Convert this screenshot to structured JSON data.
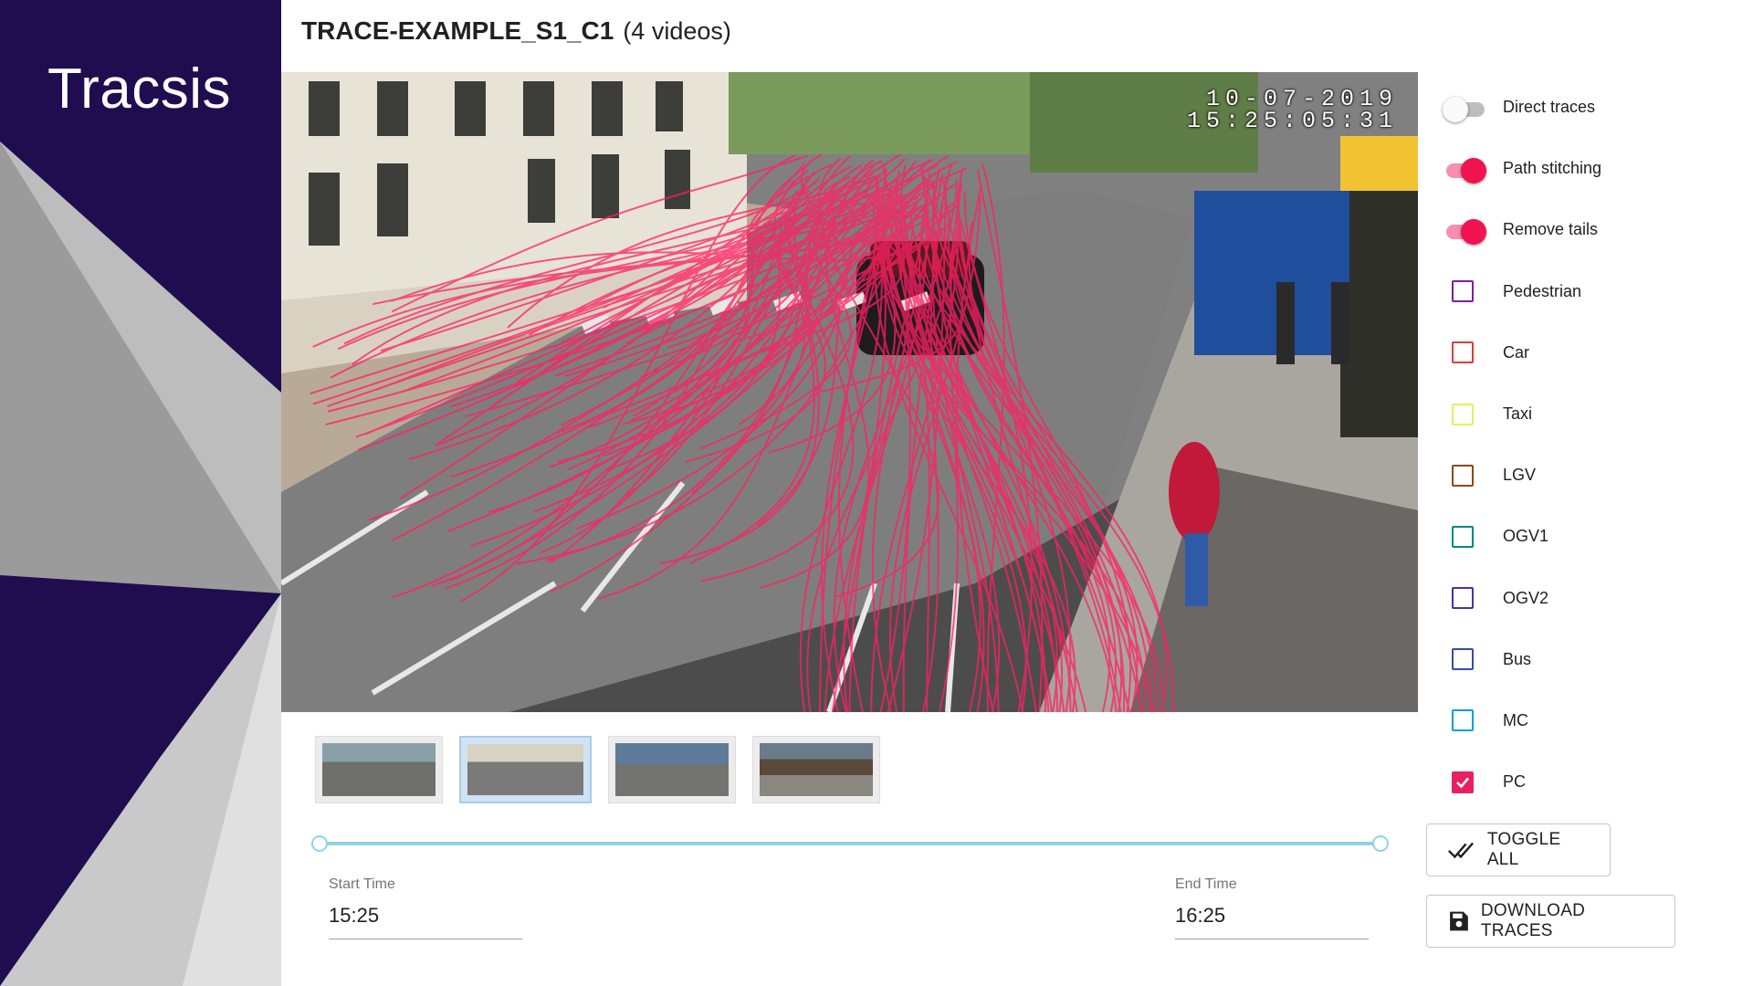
{
  "brand": {
    "logo_text": "Tracsis"
  },
  "header": {
    "title": "TRACE-EXAMPLE_S1_C1",
    "subtitle": "(4 videos)"
  },
  "video": {
    "timestamp_date": "10-07-2019",
    "timestamp_time": "15:25:05:31"
  },
  "thumbnails": [
    {
      "name": "video-1",
      "active": false
    },
    {
      "name": "video-2",
      "active": true
    },
    {
      "name": "video-3",
      "active": false
    },
    {
      "name": "video-4",
      "active": false
    }
  ],
  "time_range": {
    "start_label": "Start Time",
    "start_value": "15:25",
    "end_label": "End Time",
    "end_value": "16:25"
  },
  "toggles": [
    {
      "label": "Direct traces",
      "on": false
    },
    {
      "label": "Path stitching",
      "on": true
    },
    {
      "label": "Remove tails",
      "on": true
    }
  ],
  "classes": [
    {
      "label": "Pedestrian",
      "color": "#7b1fa2",
      "checked": false
    },
    {
      "label": "Car",
      "color": "#e53935",
      "checked": false
    },
    {
      "label": "Taxi",
      "color": "#e6ee5c",
      "checked": false
    },
    {
      "label": "LGV",
      "color": "#8d4a12",
      "checked": false
    },
    {
      "label": "OGV1",
      "color": "#00897b",
      "checked": false
    },
    {
      "label": "OGV2",
      "color": "#512da8",
      "checked": false
    },
    {
      "label": "Bus",
      "color": "#3949ab",
      "checked": false
    },
    {
      "label": "MC",
      "color": "#039be5",
      "checked": false
    },
    {
      "label": "PC",
      "color": "#e91e63",
      "checked": true
    }
  ],
  "buttons": {
    "toggle_all_label": "TOGGLE ALL",
    "toggle_all_icon": "double-check-icon",
    "download_label": "DOWNLOAD TRACES",
    "download_icon": "save-icon"
  },
  "colors": {
    "brand_dark": "#1f0d50",
    "trace": "#ff2063",
    "switch_on": "#f0134d",
    "slider": "#8fd3e8"
  }
}
